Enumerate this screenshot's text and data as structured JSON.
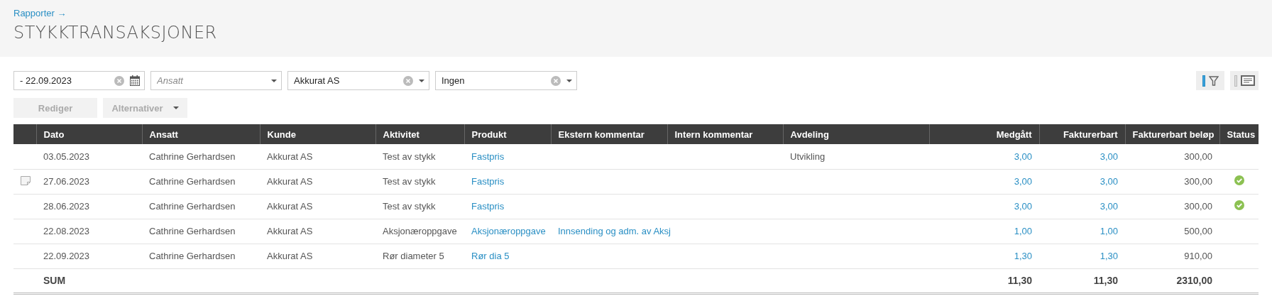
{
  "breadcrumb": "Rapporter →",
  "title": "STYKKTRANSAKSJONER",
  "filters": [
    {
      "kind": "date",
      "value": "- 22.09.2023",
      "clearable": true
    },
    {
      "kind": "select",
      "placeholder": "Ansatt",
      "clearable": false
    },
    {
      "kind": "select",
      "value": "Akkurat AS",
      "clearable": true
    },
    {
      "kind": "select",
      "value": "Ingen",
      "clearable": true
    }
  ],
  "buttons": [
    {
      "label": "Rediger",
      "disabled": true,
      "dropdown": false
    },
    {
      "label": "Alternativer",
      "disabled": true,
      "dropdown": true
    }
  ],
  "view_toggles": [
    {
      "kind": "filter",
      "selected": true
    },
    {
      "kind": "details",
      "selected": false
    }
  ],
  "table": {
    "columns": [
      "Dato",
      "Ansatt",
      "Kunde",
      "Aktivitet",
      "Produkt",
      "Ekstern kommentar",
      "Intern kommentar",
      "Avdeling",
      "Medgått",
      "Fakturerbart",
      "Fakturerbart beløp",
      "Status"
    ],
    "rows": [
      {
        "note": false,
        "dato": "03.05.2023",
        "ansatt": "Cathrine Gerhardsen",
        "kunde": "Akkurat AS",
        "aktivitet": "Test av stykk",
        "produkt": "Fastpris",
        "avdeling": "Utvikling",
        "medgatt": "3,00",
        "fakturerbart": "3,00",
        "belop": "300,00",
        "approved": false
      },
      {
        "note": true,
        "dato": "27.06.2023",
        "ansatt": "Cathrine Gerhardsen",
        "kunde": "Akkurat AS",
        "aktivitet": "Test av stykk",
        "produkt": "Fastpris",
        "medgatt": "3,00",
        "fakturerbart": "3,00",
        "belop": "300,00",
        "approved": true
      },
      {
        "note": false,
        "dato": "28.06.2023",
        "ansatt": "Cathrine Gerhardsen",
        "kunde": "Akkurat AS",
        "aktivitet": "Test av stykk",
        "produkt": "Fastpris",
        "medgatt": "3,00",
        "fakturerbart": "3,00",
        "belop": "300,00",
        "approved": true
      },
      {
        "note": false,
        "dato": "22.08.2023",
        "ansatt": "Cathrine Gerhardsen",
        "kunde": "Akkurat AS",
        "aktivitet": "Aksjonæroppgave",
        "produkt": "Aksjonæroppgave",
        "ekstern": "Innsending og adm. av Aksj",
        "medgatt": "1,00",
        "fakturerbart": "1,00",
        "belop": "500,00",
        "approved": false
      },
      {
        "note": false,
        "dato": "22.09.2023",
        "ansatt": "Cathrine Gerhardsen",
        "kunde": "Akkurat AS",
        "aktivitet": "Rør diameter 5",
        "produkt": "Rør dia 5",
        "medgatt": "1,30",
        "fakturerbart": "1,30",
        "belop": "910,00",
        "approved": false
      }
    ],
    "sum": {
      "label": "SUM",
      "medgatt": "11,30",
      "fakturerbart": "11,30",
      "belop": "2310,00"
    }
  }
}
